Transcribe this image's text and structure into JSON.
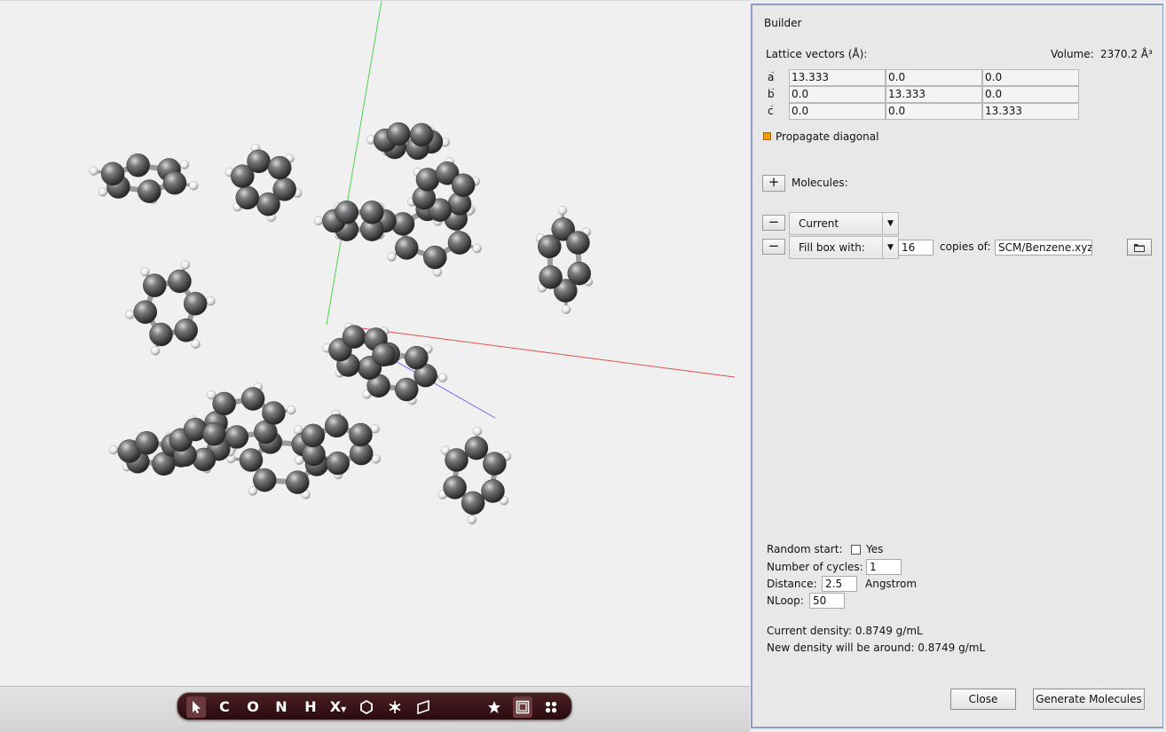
{
  "builder": {
    "title": "Builder",
    "lattice_label": "Lattice vectors (Å):",
    "volume_label": "Volume:",
    "volume_value": "2370.2 Å³",
    "lattice": [
      {
        "label": "a",
        "values": [
          "13.333",
          "0.0",
          "0.0"
        ]
      },
      {
        "label": "b",
        "values": [
          "0.0",
          "13.333",
          "0.0"
        ]
      },
      {
        "label": "c",
        "values": [
          "0.0",
          "0.0",
          "13.333"
        ]
      }
    ],
    "propagate_label": "Propagate diagonal",
    "propagate_color": "#f0a000",
    "add_button": "+",
    "molecules_label": "Molecules:",
    "remove_button": "−",
    "molecule_rows": [
      {
        "combo": "Current"
      },
      {
        "combo": "Fill box with:",
        "copies_value": "16",
        "copies_label": "copies of:",
        "file_value": "SCM/Benzene.xyz",
        "icon": "folder-icon"
      }
    ],
    "random_start_label": "Random start:",
    "random_start_option": "Yes",
    "cycles_label": "Number of cycles:",
    "cycles_value": "1",
    "distance_label": "Distance:",
    "distance_value": "2.5",
    "distance_unit": "Angstrom",
    "nloop_label": "NLoop:",
    "nloop_value": "50",
    "current_density": "Current density: 0.8749 g/mL",
    "new_density": "New density will be around: 0.8749 g/mL",
    "close_button": "Close",
    "generate_button": "Generate Molecules"
  },
  "toolbar": {
    "items": [
      {
        "name": "select-tool",
        "icon": "cursor-icon",
        "text": ""
      },
      {
        "name": "carbon-tool",
        "text": "C"
      },
      {
        "name": "oxygen-tool",
        "text": "O"
      },
      {
        "name": "nitrogen-tool",
        "text": "N"
      },
      {
        "name": "hydrogen-tool",
        "text": "H"
      },
      {
        "name": "element-tool",
        "text": "X"
      },
      {
        "name": "ring-tool",
        "icon": "hexagon-icon",
        "text": ""
      },
      {
        "name": "structure-tool",
        "icon": "snowflake-icon",
        "text": ""
      },
      {
        "name": "plane-tool",
        "icon": "plane-icon",
        "text": ""
      },
      {
        "name": "favorite-tool",
        "icon": "star-icon",
        "text": ""
      },
      {
        "name": "box-tool",
        "icon": "box-icon",
        "text": ""
      },
      {
        "name": "molecules-tool",
        "icon": "dots-icon",
        "text": ""
      }
    ]
  },
  "scene": {
    "axis_colors": {
      "x": "#e05050",
      "y": "#50d050",
      "z": "#6a6aee"
    },
    "carbon_color": "#5a5a5a",
    "hydrogen_color": "#ffffff",
    "molecule_count": 16
  }
}
